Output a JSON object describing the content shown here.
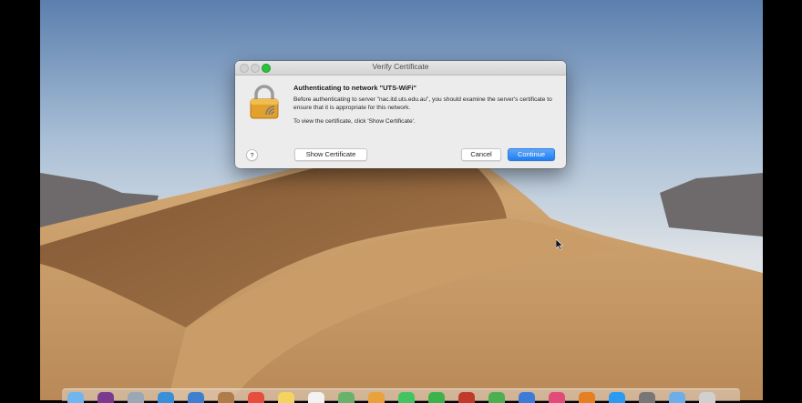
{
  "dialog": {
    "title": "Verify Certificate",
    "heading": "Authenticating to network \"UTS-WiFi\"",
    "message": "Before authenticating to server \"nac.itd.uts.edu.au\", you should examine the server's certificate to ensure that it is appropriate for this network.",
    "hint": "To view the certificate, click 'Show Certificate'.",
    "help_label": "?",
    "show_certificate_label": "Show Certificate",
    "cancel_label": "Cancel",
    "continue_label": "Continue"
  },
  "dock": {
    "icons": [
      {
        "name": "finder-icon",
        "color": "#6fb6ef"
      },
      {
        "name": "siri-icon",
        "color": "#7a3b8f"
      },
      {
        "name": "launchpad-icon",
        "color": "#9aa7b5"
      },
      {
        "name": "safari-icon",
        "color": "#3a8fd9"
      },
      {
        "name": "mail-icon",
        "color": "#3f7fd0"
      },
      {
        "name": "contacts-icon",
        "color": "#b07d4a"
      },
      {
        "name": "calendar-icon",
        "color": "#e74c3c"
      },
      {
        "name": "notes-icon",
        "color": "#f4d35e"
      },
      {
        "name": "reminders-icon",
        "color": "#f2f2f2"
      },
      {
        "name": "maps-icon",
        "color": "#68b26b"
      },
      {
        "name": "photos-icon",
        "color": "#e9a23b"
      },
      {
        "name": "messages-icon",
        "color": "#43c463"
      },
      {
        "name": "facetime-icon",
        "color": "#3cb34a"
      },
      {
        "name": "photo-booth-icon",
        "color": "#c0392b"
      },
      {
        "name": "numbers-icon",
        "color": "#4caf50"
      },
      {
        "name": "keynote-icon",
        "color": "#3d7bd9"
      },
      {
        "name": "itunes-icon",
        "color": "#e04b7a"
      },
      {
        "name": "books-icon",
        "color": "#e67e22"
      },
      {
        "name": "app-store-icon",
        "color": "#2a9bf0"
      },
      {
        "name": "system-preferences-icon",
        "color": "#777777"
      },
      {
        "name": "folder-icon",
        "color": "#6baee8"
      },
      {
        "name": "trash-icon",
        "color": "#d0d0d0"
      }
    ]
  }
}
